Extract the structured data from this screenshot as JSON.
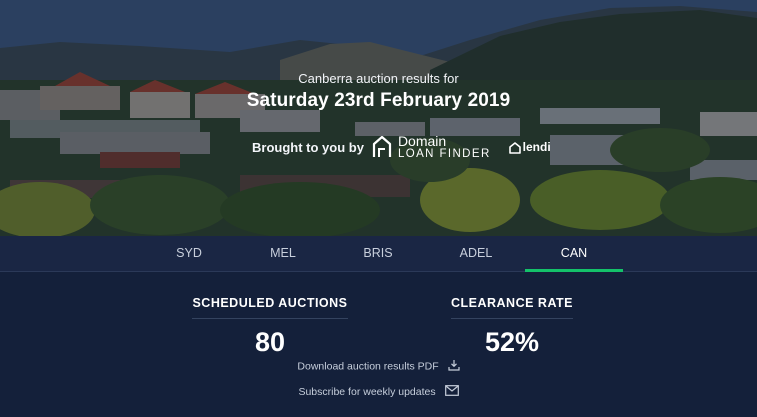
{
  "hero": {
    "subtitle": "Canberra auction results for",
    "date": "Saturday 23rd February 2019",
    "sponsor_text": "Brought to you by",
    "domain_word": "Domain",
    "loan_finder_word": "LOAN FINDER",
    "lendi_word": "lendi"
  },
  "tabs": [
    {
      "label": "SYD"
    },
    {
      "label": "MEL"
    },
    {
      "label": "BRIS"
    },
    {
      "label": "ADEL"
    },
    {
      "label": "CAN"
    }
  ],
  "active_tab": "CAN",
  "stats": {
    "scheduled_label": "SCHEDULED AUCTIONS",
    "scheduled_value": "80",
    "clearance_label": "CLEARANCE RATE",
    "clearance_value": "52%"
  },
  "links": {
    "download": "Download auction results PDF",
    "subscribe": "Subscribe for weekly updates"
  },
  "colors": {
    "accent": "#14c26a",
    "panel": "#14203a",
    "tabbar": "#1a2644"
  },
  "icons": {
    "download": "download-icon",
    "subscribe": "mail-icon",
    "domain": "house-icon",
    "lendi": "lendi-icon"
  }
}
